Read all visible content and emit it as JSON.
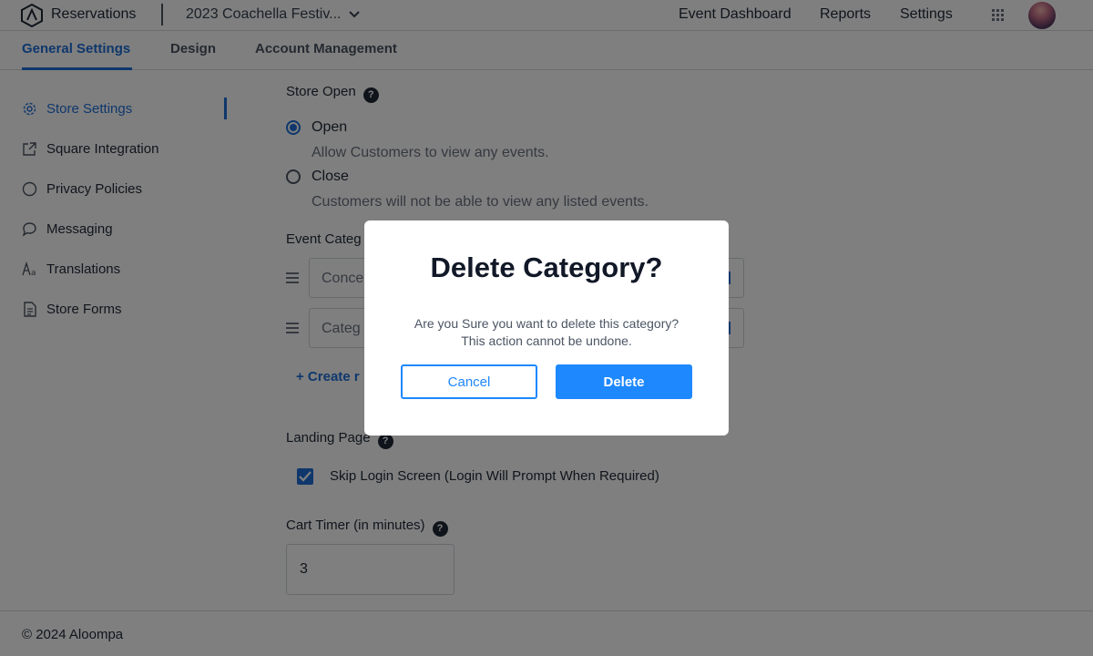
{
  "header": {
    "app_title": "Reservations",
    "event_selector": "2023 Coachella Festiv...",
    "nav": [
      "Event Dashboard",
      "Reports",
      "Settings"
    ]
  },
  "tabs": [
    "General Settings",
    "Design",
    "Account Management"
  ],
  "sidebar": {
    "items": [
      {
        "label": "Store Settings",
        "icon": "gear-icon"
      },
      {
        "label": "Square Integration",
        "icon": "external-link-icon"
      },
      {
        "label": "Privacy Policies",
        "icon": "circle-icon"
      },
      {
        "label": "Messaging",
        "icon": "chat-bubble-icon"
      },
      {
        "label": "Translations",
        "icon": "text-aa-icon"
      },
      {
        "label": "Store Forms",
        "icon": "document-icon"
      }
    ]
  },
  "main": {
    "store_open_label": "Store Open",
    "open_label": "Open",
    "open_desc": "Allow Customers to view any events.",
    "close_label": "Close",
    "close_desc": "Customers will not be able to view any listed events.",
    "event_categories_label": "Event Categ",
    "category_1": "Conce",
    "category_2": "Categ",
    "create_link": "+ Create r",
    "landing_page_label": "Landing Page",
    "skip_login_label": "Skip Login Screen (Login Will Prompt When Required)",
    "cart_timer_label": "Cart Timer (in minutes)",
    "cart_timer_value": "3"
  },
  "footer": {
    "copyright": "© 2024 Aloompa"
  },
  "modal": {
    "title": "Delete Category?",
    "body_line1": "Are you Sure you want to delete this category?",
    "body_line2": "This action cannot be undone.",
    "cancel_label": "Cancel",
    "delete_label": "Delete"
  },
  "colors": {
    "accent": "#1e6fd9",
    "button": "#1e88ff"
  }
}
